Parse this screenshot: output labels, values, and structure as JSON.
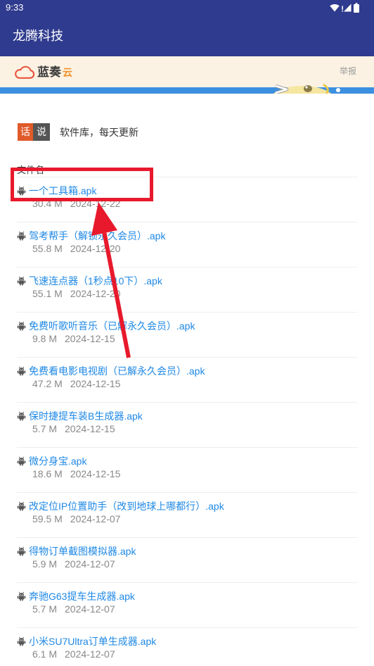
{
  "theme": {
    "app_bar_color": "#2f3b8e",
    "banner_color": "#fcf2e3",
    "banner_strip_color": "#3d8fe0",
    "link_color": "#1e88e5",
    "meta_color": "#888888",
    "divider_color": "#eeeeee",
    "badge_left_color": "#e05a2a",
    "badge_right_color": "#555555",
    "annotation_color": "#e8192c"
  },
  "status_bar": {
    "time": "9:33",
    "icons": [
      "wifi-icon",
      "signal-icon",
      "battery-icon"
    ]
  },
  "app_bar": {
    "title": "龙腾科技"
  },
  "banner": {
    "logo_icon": "cloud-icon",
    "logo_text": "蓝奏",
    "logo_suffix": "云",
    "report_label": "举报"
  },
  "notice": {
    "badge_left": "话",
    "badge_right": "说",
    "text": "软件库，每天更新"
  },
  "file_list": {
    "header": "文件名",
    "item_icon": "android-icon",
    "items": [
      {
        "name": "一个工具箱.apk",
        "size": "30.4 M",
        "date": "2024-12-22"
      },
      {
        "name": "驾考帮手（解锁永久会员）.apk",
        "size": "55.8 M",
        "date": "2024-12-20"
      },
      {
        "name": "飞速连点器（1秒点10下）.apk",
        "size": "55.1 M",
        "date": "2024-12-20"
      },
      {
        "name": "免费听歌听音乐（已解永久会员）.apk",
        "size": "9.8 M",
        "date": "2024-12-15"
      },
      {
        "name": "免费看电影电视剧（已解永久会员）.apk",
        "size": "47.2 M",
        "date": "2024-12-15"
      },
      {
        "name": "保时捷提车装B生成器.apk",
        "size": "5.7 M",
        "date": "2024-12-15"
      },
      {
        "name": "微分身宝.apk",
        "size": "18.6 M",
        "date": "2024-12-15"
      },
      {
        "name": "改定位IP位置助手（改到地球上哪都行）.apk",
        "size": "59.5 M",
        "date": "2024-12-07"
      },
      {
        "name": "得物订单截图模拟器.apk",
        "size": "5.9 M",
        "date": "2024-12-07"
      },
      {
        "name": "奔驰G63提车生成器.apk",
        "size": "5.7 M",
        "date": "2024-12-07"
      },
      {
        "name": "小米SU7Ultra订单生成器.apk",
        "size": "6.1 M",
        "date": "2024-12-07"
      }
    ]
  }
}
